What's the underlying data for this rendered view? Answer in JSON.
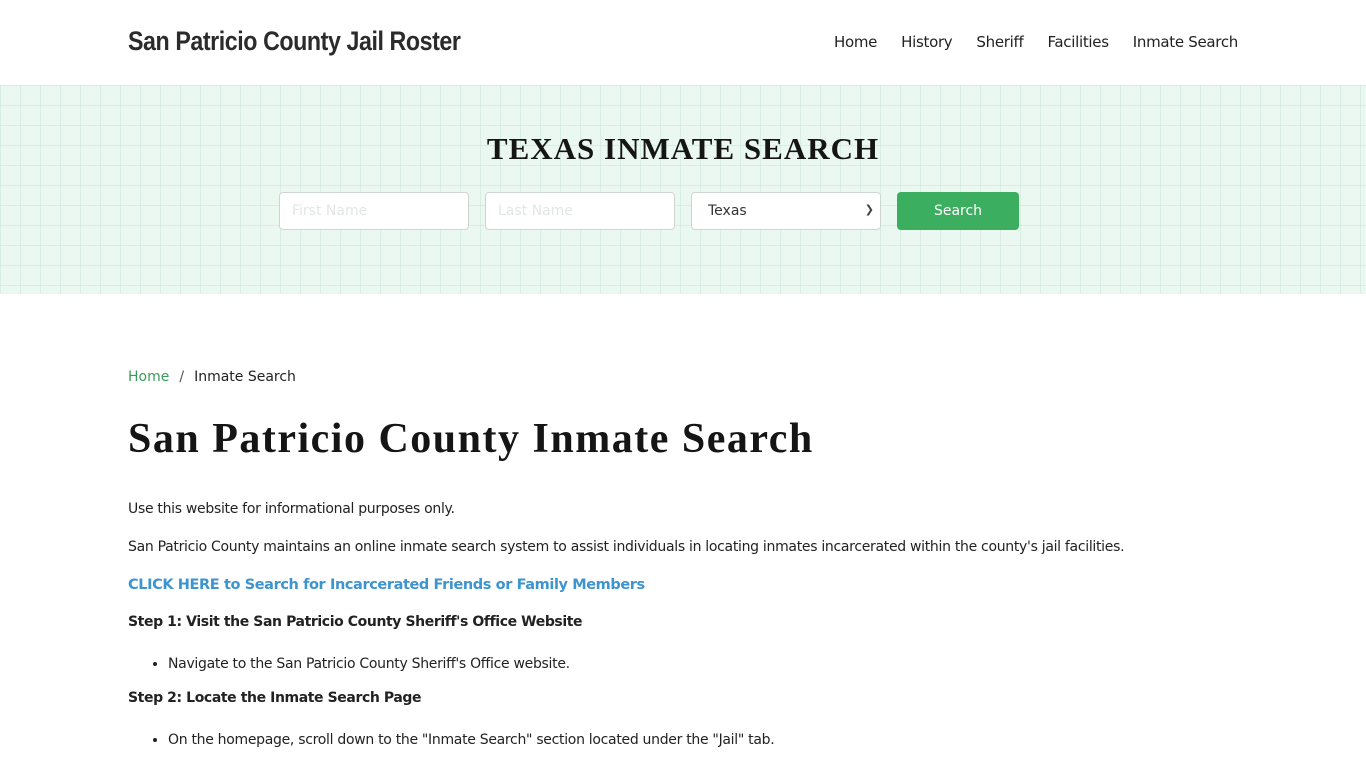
{
  "header": {
    "brand": "San Patricio County Jail Roster",
    "nav": [
      {
        "label": "Home"
      },
      {
        "label": "History"
      },
      {
        "label": "Sheriff"
      },
      {
        "label": "Facilities"
      },
      {
        "label": "Inmate Search"
      }
    ]
  },
  "hero": {
    "title": "TEXAS INMATE SEARCH",
    "first_name_placeholder": "First Name",
    "last_name_placeholder": "Last Name",
    "state_selected": "Texas",
    "search_label": "Search"
  },
  "breadcrumb": {
    "home": "Home",
    "separator": "/",
    "current": "Inmate Search"
  },
  "main": {
    "title": "San Patricio County Inmate Search",
    "paragraph1": "Use this website for informational purposes only.",
    "paragraph2": "San Patricio County maintains an online inmate search system to assist individuals in locating inmates incarcerated within the county's jail facilities.",
    "cta_link": "CLICK HERE to Search for Incarcerated Friends or Family Members",
    "steps": [
      {
        "heading": "Step 1: Visit the San Patricio County Sheriff's Office Website",
        "items": [
          "Navigate to the San Patricio County Sheriff's Office website."
        ]
      },
      {
        "heading": "Step 2: Locate the Inmate Search Page",
        "items": [
          "On the homepage, scroll down to the \"Inmate Search\" section located under the \"Jail\" tab."
        ]
      }
    ]
  },
  "colors": {
    "accent_green": "#3cae5f",
    "link_blue": "#3d94cf",
    "hero_bg": "#eaf8f1"
  }
}
